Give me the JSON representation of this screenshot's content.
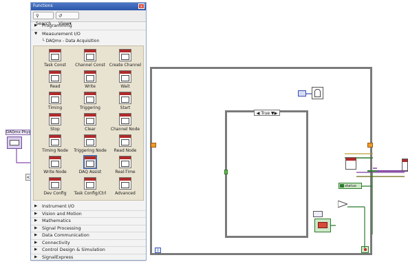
{
  "palette": {
    "title": "Functions",
    "close_glyph": "x",
    "search_label": "Search",
    "view_label": "View",
    "categories_top": [
      {
        "label": "Programming",
        "expanded": false
      },
      {
        "label": "Measurement I/O",
        "expanded": true
      }
    ],
    "subpath": "DAQmx - Data Acquisition",
    "vis": [
      {
        "label": "Task Const"
      },
      {
        "label": "Channel Const"
      },
      {
        "label": "Create Channel"
      },
      {
        "label": "Read"
      },
      {
        "label": "Write"
      },
      {
        "label": "Wait"
      },
      {
        "label": "Timing"
      },
      {
        "label": "Triggering"
      },
      {
        "label": "Start"
      },
      {
        "label": "Stop"
      },
      {
        "label": "Clear"
      },
      {
        "label": "Channel Node"
      },
      {
        "label": "Timing Node"
      },
      {
        "label": "Triggering Node"
      },
      {
        "label": "Read Node"
      },
      {
        "label": "Write Node"
      },
      {
        "label": "DAQ Assist"
      },
      {
        "label": "Real-Time"
      },
      {
        "label": "Dev Config"
      },
      {
        "label": "Task Config/Ctrl"
      },
      {
        "label": "Advanced"
      }
    ],
    "categories_bottom": [
      {
        "label": "Instrument I/O"
      },
      {
        "label": "Vision and Motion"
      },
      {
        "label": "Mathematics"
      },
      {
        "label": "Signal Processing"
      },
      {
        "label": "Data Communication"
      },
      {
        "label": "Connectivity"
      },
      {
        "label": "Control Design & Simulation"
      },
      {
        "label": "SignalExpress"
      }
    ]
  },
  "diagram": {
    "left_node_label": "DAQmx Phys",
    "case_selector": "True",
    "status_label": "status",
    "loop_index": "i",
    "left_sidebar_glyph": "<"
  }
}
